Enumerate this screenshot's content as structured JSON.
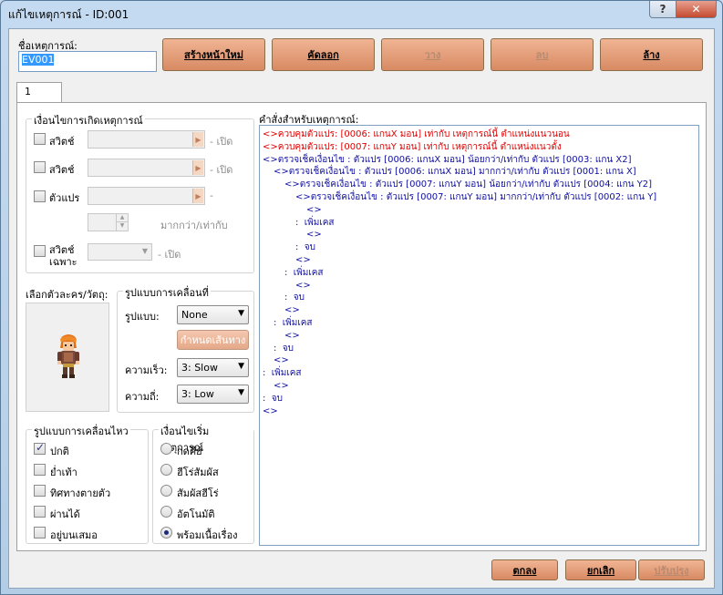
{
  "window": {
    "title": "แก้ไขเหตุการณ์ - ID:001",
    "help_label": "?",
    "close_label": "✕"
  },
  "event_name": {
    "label": "ชื่อเหตุการณ์:",
    "value": "EV001"
  },
  "toolbar": {
    "new_page": "สร้างหน้าใหม่",
    "copy": "คัดลอก",
    "paste": "วาง",
    "delete": "ลบ",
    "clear": "ล้าง"
  },
  "tabs": {
    "page1": "1"
  },
  "conditions": {
    "title": "เงื่อนไขการเกิดเหตุการณ์",
    "switch1_label": "สวิตช์",
    "switch1_suffix": "- เปิด",
    "switch2_label": "สวิตช์",
    "switch2_suffix": "- เปิด",
    "variable_label": "ตัวแปร",
    "variable_suffix": "-",
    "variable_compare": "มากกว่า/เท่ากับ",
    "self_switch_label_1": "สวิตช์",
    "self_switch_label_2": "เฉพาะ",
    "self_switch_suffix": "- เปิด"
  },
  "graphic": {
    "label": "เลือกตัวละคร/วัตถุ:"
  },
  "movement": {
    "title": "รูปแบบการเคลื่อนที่",
    "type_label": "รูปแบบ:",
    "type_value": "None",
    "route_button": "กำหนดเส้นทาง",
    "speed_label": "ความเร็ว:",
    "speed_value": "3: Slow",
    "freq_label": "ความถี่:",
    "freq_value": "3: Low"
  },
  "options": {
    "title": "รูปแบบการเคลื่อนไหว",
    "items": [
      {
        "label": "ปกติ",
        "checked": true
      },
      {
        "label": "ย่ำเท้า",
        "checked": false
      },
      {
        "label": "ทิศทางตายตัว",
        "checked": false
      },
      {
        "label": "ผ่านได้",
        "checked": false
      },
      {
        "label": "อยู่บนเสมอ",
        "checked": false
      }
    ]
  },
  "trigger": {
    "title": "เงื่อนไขเริ่มเหตุการณ์",
    "items": [
      {
        "label": "กดคีย์",
        "selected": false
      },
      {
        "label": "ฮีโร่สัมผัส",
        "selected": false
      },
      {
        "label": "สัมผัสฮีโร่",
        "selected": false
      },
      {
        "label": "อัตโนมัติ",
        "selected": false
      },
      {
        "label": "พร้อมเนื้อเรื่อง",
        "selected": true
      }
    ]
  },
  "commands": {
    "label": "คำสั่งสำหรับเหตุการณ์:",
    "lines": [
      {
        "text": "<>ควบคุมตัวแปร: [0006: แกนX มอน] เท่ากับ เหตุการณ์นี้ ตำแหน่งแนวนอน",
        "color": "red",
        "indent": 0
      },
      {
        "text": "<>ควบคุมตัวแปร: [0007: แกนY มอน] เท่ากับ เหตุการณ์นี้ ตำแหน่งแนวตั้ง",
        "color": "red",
        "indent": 0
      },
      {
        "text": "<>ตรวจเช็คเงื่อนไข : ตัวแปร [0006: แกนX มอน] น้อยกว่า/เท่ากับ ตัวแปร [0003: แกน X2]",
        "color": "blue",
        "indent": 0
      },
      {
        "text": "<>ตรวจเช็คเงื่อนไข : ตัวแปร [0006: แกนX มอน] มากกว่า/เท่ากับ ตัวแปร [0001: แกน X]",
        "color": "blue",
        "indent": 1
      },
      {
        "text": "<>ตรวจเช็คเงื่อนไข : ตัวแปร [0007: แกนY มอน] น้อยกว่า/เท่ากับ ตัวแปร [0004: แกน Y2]",
        "color": "blue",
        "indent": 2
      },
      {
        "text": "<>ตรวจเช็คเงื่อนไข : ตัวแปร [0007: แกนY มอน] มากกว่า/เท่ากับ ตัวแปร [0002: แกน Y]",
        "color": "blue",
        "indent": 3
      },
      {
        "text": "<>",
        "color": "blue",
        "indent": 4
      },
      {
        "text": ":  เพิ่มเคส",
        "color": "blue",
        "indent": 3
      },
      {
        "text": "<>",
        "color": "blue",
        "indent": 4
      },
      {
        "text": ":  จบ",
        "color": "blue",
        "indent": 3
      },
      {
        "text": "<>",
        "color": "blue",
        "indent": 3
      },
      {
        "text": ":  เพิ่มเคส",
        "color": "blue",
        "indent": 2
      },
      {
        "text": "<>",
        "color": "blue",
        "indent": 3
      },
      {
        "text": ":  จบ",
        "color": "blue",
        "indent": 2
      },
      {
        "text": "<>",
        "color": "blue",
        "indent": 2
      },
      {
        "text": ":  เพิ่มเคส",
        "color": "blue",
        "indent": 1
      },
      {
        "text": "<>",
        "color": "blue",
        "indent": 2
      },
      {
        "text": ":  จบ",
        "color": "blue",
        "indent": 1
      },
      {
        "text": "<>",
        "color": "blue",
        "indent": 1
      },
      {
        "text": ":  เพิ่มเคส",
        "color": "blue",
        "indent": 0
      },
      {
        "text": "<>",
        "color": "blue",
        "indent": 1
      },
      {
        "text": ":  จบ",
        "color": "blue",
        "indent": 0
      },
      {
        "text": "<>",
        "color": "blue",
        "indent": 0
      }
    ]
  },
  "footer": {
    "ok": "ตกลง",
    "cancel": "ยกเลิก",
    "apply": "ปรับปรุง"
  }
}
